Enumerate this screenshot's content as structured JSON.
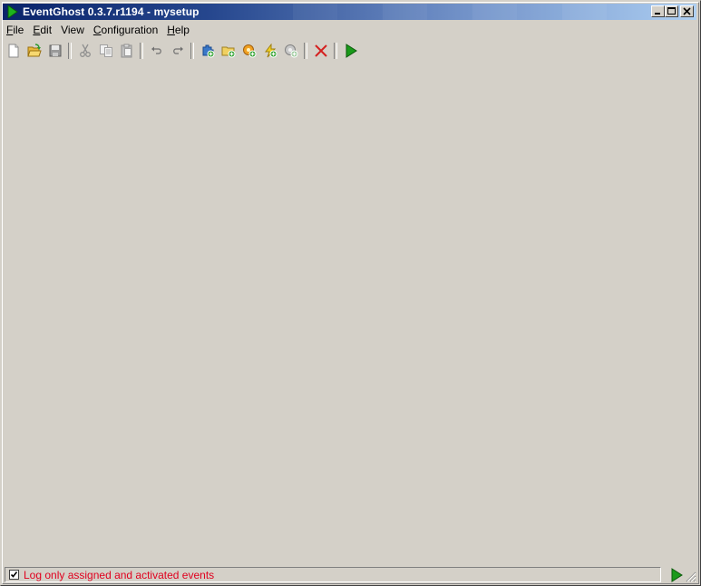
{
  "window": {
    "title": "EventGhost 0.3.7.r1194 - mysetup"
  },
  "menu": [
    {
      "label": "File",
      "acc": "F",
      "rest": "ile"
    },
    {
      "label": "Edit",
      "acc": "E",
      "rest": "dit"
    },
    {
      "label": "View",
      "acc": "",
      "rest": "View"
    },
    {
      "label": "Configuration",
      "acc": "C",
      "rest": "onfiguration"
    },
    {
      "label": "Help",
      "acc": "H",
      "rest": "elp"
    }
  ],
  "toolbar": {
    "icons": [
      "new-file-icon",
      "open-folder-icon",
      "save-icon",
      "cut-icon",
      "copy-icon",
      "paste-icon",
      "undo-icon",
      "redo-icon",
      "add-plugin-icon",
      "add-folder-icon",
      "add-macro-icon",
      "add-event-icon",
      "add-action-icon",
      "delete-icon",
      "execute-icon"
    ]
  },
  "statusbar": {
    "checkbox_checked": true,
    "label": "Log only assigned and activated events"
  },
  "colors": {
    "title_start": "#0a246a",
    "title_end": "#a6caf0",
    "status_text": "#e0001e",
    "run_green": "#1a9a1a",
    "delete_red": "#d42020"
  }
}
